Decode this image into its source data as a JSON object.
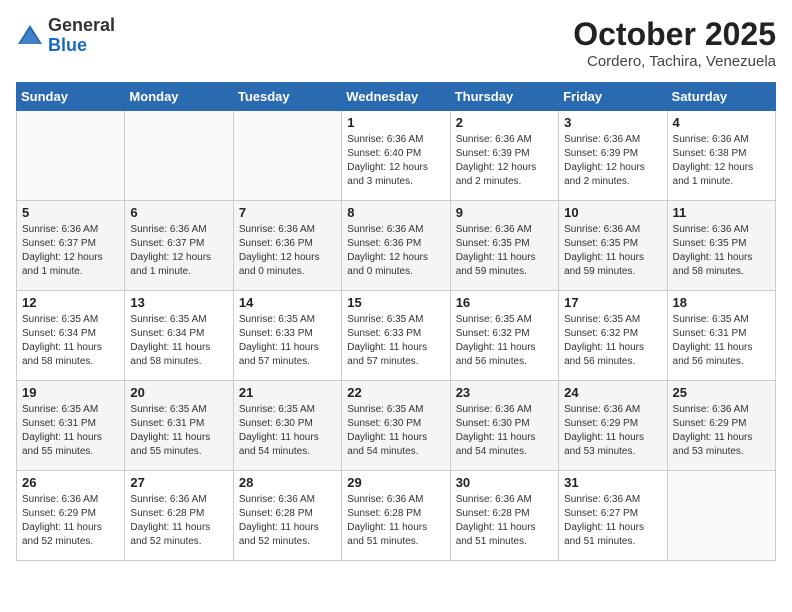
{
  "header": {
    "logo_general": "General",
    "logo_blue": "Blue",
    "month_title": "October 2025",
    "location": "Cordero, Tachira, Venezuela"
  },
  "days_of_week": [
    "Sunday",
    "Monday",
    "Tuesday",
    "Wednesday",
    "Thursday",
    "Friday",
    "Saturday"
  ],
  "weeks": [
    [
      {
        "day": "",
        "info": ""
      },
      {
        "day": "",
        "info": ""
      },
      {
        "day": "",
        "info": ""
      },
      {
        "day": "1",
        "info": "Sunrise: 6:36 AM\nSunset: 6:40 PM\nDaylight: 12 hours\nand 3 minutes."
      },
      {
        "day": "2",
        "info": "Sunrise: 6:36 AM\nSunset: 6:39 PM\nDaylight: 12 hours\nand 2 minutes."
      },
      {
        "day": "3",
        "info": "Sunrise: 6:36 AM\nSunset: 6:39 PM\nDaylight: 12 hours\nand 2 minutes."
      },
      {
        "day": "4",
        "info": "Sunrise: 6:36 AM\nSunset: 6:38 PM\nDaylight: 12 hours\nand 1 minute."
      }
    ],
    [
      {
        "day": "5",
        "info": "Sunrise: 6:36 AM\nSunset: 6:37 PM\nDaylight: 12 hours\nand 1 minute."
      },
      {
        "day": "6",
        "info": "Sunrise: 6:36 AM\nSunset: 6:37 PM\nDaylight: 12 hours\nand 1 minute."
      },
      {
        "day": "7",
        "info": "Sunrise: 6:36 AM\nSunset: 6:36 PM\nDaylight: 12 hours\nand 0 minutes."
      },
      {
        "day": "8",
        "info": "Sunrise: 6:36 AM\nSunset: 6:36 PM\nDaylight: 12 hours\nand 0 minutes."
      },
      {
        "day": "9",
        "info": "Sunrise: 6:36 AM\nSunset: 6:35 PM\nDaylight: 11 hours\nand 59 minutes."
      },
      {
        "day": "10",
        "info": "Sunrise: 6:36 AM\nSunset: 6:35 PM\nDaylight: 11 hours\nand 59 minutes."
      },
      {
        "day": "11",
        "info": "Sunrise: 6:36 AM\nSunset: 6:35 PM\nDaylight: 11 hours\nand 58 minutes."
      }
    ],
    [
      {
        "day": "12",
        "info": "Sunrise: 6:35 AM\nSunset: 6:34 PM\nDaylight: 11 hours\nand 58 minutes."
      },
      {
        "day": "13",
        "info": "Sunrise: 6:35 AM\nSunset: 6:34 PM\nDaylight: 11 hours\nand 58 minutes."
      },
      {
        "day": "14",
        "info": "Sunrise: 6:35 AM\nSunset: 6:33 PM\nDaylight: 11 hours\nand 57 minutes."
      },
      {
        "day": "15",
        "info": "Sunrise: 6:35 AM\nSunset: 6:33 PM\nDaylight: 11 hours\nand 57 minutes."
      },
      {
        "day": "16",
        "info": "Sunrise: 6:35 AM\nSunset: 6:32 PM\nDaylight: 11 hours\nand 56 minutes."
      },
      {
        "day": "17",
        "info": "Sunrise: 6:35 AM\nSunset: 6:32 PM\nDaylight: 11 hours\nand 56 minutes."
      },
      {
        "day": "18",
        "info": "Sunrise: 6:35 AM\nSunset: 6:31 PM\nDaylight: 11 hours\nand 56 minutes."
      }
    ],
    [
      {
        "day": "19",
        "info": "Sunrise: 6:35 AM\nSunset: 6:31 PM\nDaylight: 11 hours\nand 55 minutes."
      },
      {
        "day": "20",
        "info": "Sunrise: 6:35 AM\nSunset: 6:31 PM\nDaylight: 11 hours\nand 55 minutes."
      },
      {
        "day": "21",
        "info": "Sunrise: 6:35 AM\nSunset: 6:30 PM\nDaylight: 11 hours\nand 54 minutes."
      },
      {
        "day": "22",
        "info": "Sunrise: 6:35 AM\nSunset: 6:30 PM\nDaylight: 11 hours\nand 54 minutes."
      },
      {
        "day": "23",
        "info": "Sunrise: 6:36 AM\nSunset: 6:30 PM\nDaylight: 11 hours\nand 54 minutes."
      },
      {
        "day": "24",
        "info": "Sunrise: 6:36 AM\nSunset: 6:29 PM\nDaylight: 11 hours\nand 53 minutes."
      },
      {
        "day": "25",
        "info": "Sunrise: 6:36 AM\nSunset: 6:29 PM\nDaylight: 11 hours\nand 53 minutes."
      }
    ],
    [
      {
        "day": "26",
        "info": "Sunrise: 6:36 AM\nSunset: 6:29 PM\nDaylight: 11 hours\nand 52 minutes."
      },
      {
        "day": "27",
        "info": "Sunrise: 6:36 AM\nSunset: 6:28 PM\nDaylight: 11 hours\nand 52 minutes."
      },
      {
        "day": "28",
        "info": "Sunrise: 6:36 AM\nSunset: 6:28 PM\nDaylight: 11 hours\nand 52 minutes."
      },
      {
        "day": "29",
        "info": "Sunrise: 6:36 AM\nSunset: 6:28 PM\nDaylight: 11 hours\nand 51 minutes."
      },
      {
        "day": "30",
        "info": "Sunrise: 6:36 AM\nSunset: 6:28 PM\nDaylight: 11 hours\nand 51 minutes."
      },
      {
        "day": "31",
        "info": "Sunrise: 6:36 AM\nSunset: 6:27 PM\nDaylight: 11 hours\nand 51 minutes."
      },
      {
        "day": "",
        "info": ""
      }
    ]
  ]
}
